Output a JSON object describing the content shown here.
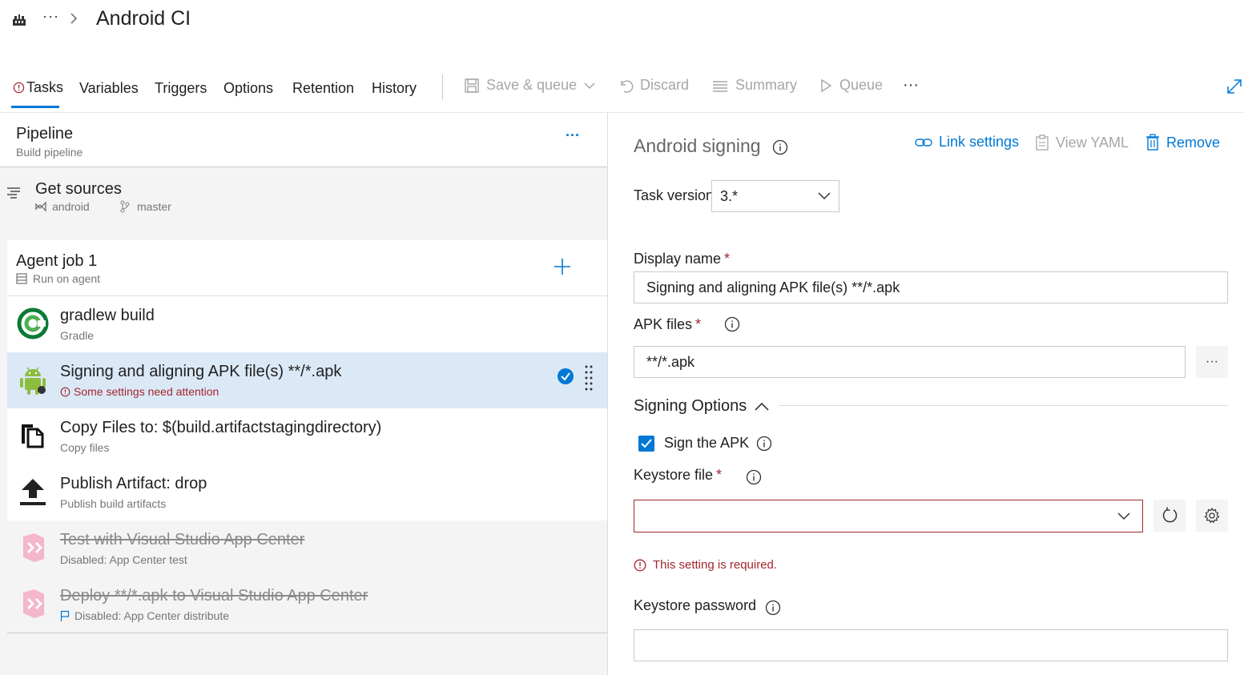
{
  "header": {
    "breadcrumb_dots": "···",
    "title": "Android CI"
  },
  "tabs": [
    {
      "label": "Tasks",
      "active": true
    },
    {
      "label": "Variables"
    },
    {
      "label": "Triggers"
    },
    {
      "label": "Options"
    },
    {
      "label": "Retention"
    },
    {
      "label": "History"
    }
  ],
  "toolbar": {
    "save_queue": "Save & queue",
    "discard": "Discard",
    "summary": "Summary",
    "queue": "Queue",
    "more": "···"
  },
  "pipeline": {
    "title": "Pipeline",
    "subtitle": "Build pipeline",
    "more": "···"
  },
  "get_sources": {
    "title": "Get sources",
    "repo": "android",
    "branch": "master"
  },
  "agent_job": {
    "title": "Agent job 1",
    "subtitle": "Run on agent"
  },
  "tasks": [
    {
      "title": "gradlew build",
      "subtitle": "Gradle",
      "icon": "gradle-icon"
    },
    {
      "title": "Signing and aligning APK file(s) **/*.apk",
      "subtitle": "Some settings need attention",
      "icon": "android-icon",
      "selected": true,
      "warning": true
    },
    {
      "title": "Copy Files to: $(build.artifactstagingdirectory)",
      "subtitle": "Copy files",
      "icon": "copy-files-icon"
    },
    {
      "title": "Publish Artifact: drop",
      "subtitle": "Publish build artifacts",
      "icon": "upload-icon"
    },
    {
      "title": "Test with Visual Studio App Center",
      "subtitle": "Disabled: App Center test",
      "icon": "app-center-icon",
      "disabled": true
    },
    {
      "title": "Deploy **/*.apk to Visual Studio App Center",
      "subtitle": "Disabled: App Center distribute",
      "icon": "app-center-icon",
      "disabled": true
    }
  ],
  "details": {
    "title": "Android signing",
    "link_settings": "Link settings",
    "view_yaml": "View YAML",
    "remove": "Remove",
    "task_version_label": "Task version",
    "task_version_value": "3.*",
    "display_name_label": "Display name",
    "display_name_value": "Signing and aligning APK file(s) **/*.apk",
    "apk_files_label": "APK files",
    "apk_files_value": "**/*.apk",
    "browse": "···",
    "signing_options_label": "Signing Options",
    "sign_apk_label": "Sign the APK",
    "sign_apk_checked": true,
    "keystore_file_label": "Keystore file",
    "keystore_file_value": "",
    "keystore_error": "This setting is required.",
    "keystore_password_label": "Keystore password",
    "keystore_password_value": "",
    "required_mark": "*"
  },
  "colors": {
    "accent": "#0078d4",
    "error": "#a4262c",
    "selected_row": "#dbe9f7",
    "muted": "#a6a6a6"
  }
}
